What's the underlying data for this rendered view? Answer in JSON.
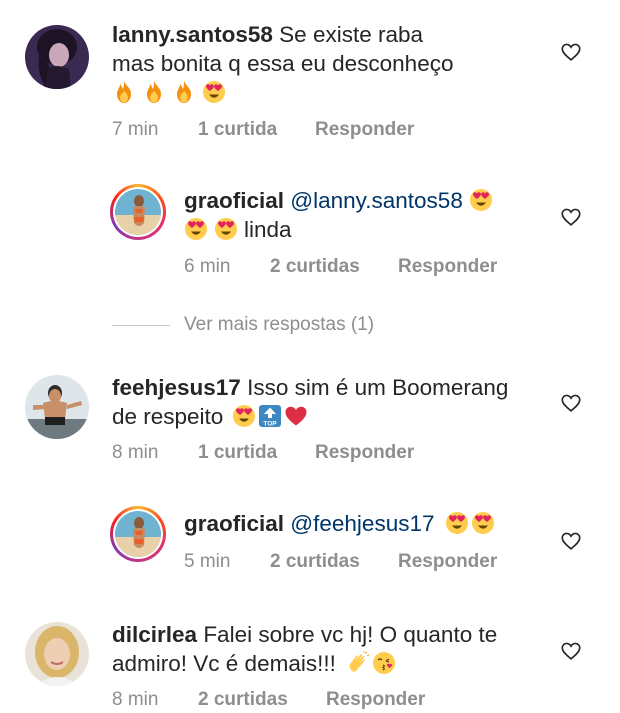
{
  "comments": [
    {
      "user": "lanny.santos58",
      "text_line1": "Se existe raba",
      "text_line2": "mas bonita q essa eu desconheço",
      "emojis": [
        "fire-emoji",
        "fire-emoji",
        "fire-emoji",
        "heart-eyes-emoji"
      ],
      "time": "7 min",
      "likes": "1 curtida",
      "reply": "Responder"
    },
    {
      "user": "graoficial",
      "mention": "@lanny.santos58",
      "text_line2_suffix": "linda",
      "time": "6 min",
      "likes": "2 curtidas",
      "reply": "Responder"
    },
    {
      "view_more": "Ver mais respostas (1)"
    },
    {
      "user": "feehjesus17",
      "text_line1": "Isso sim é um Boomerang",
      "text_line2": "de respeito",
      "time": "8 min",
      "likes": "1 curtida",
      "reply": "Responder"
    },
    {
      "user": "graoficial",
      "mention": "@feehjesus17",
      "time": "5 min",
      "likes": "2 curtidas",
      "reply": "Responder"
    },
    {
      "user": "dilcirlea",
      "text_line1": "Falei sobre vc hj! O quanto te",
      "text_line2": "admiro! Vc é demais!!!",
      "time": "8 min",
      "likes": "2 curtidas",
      "reply": "Responder"
    }
  ],
  "icons": {
    "like": "heart-outline-icon",
    "colors": {
      "text": "#262626",
      "meta": "#8e8e8e",
      "mention": "#003569",
      "heart": "#262626"
    }
  }
}
